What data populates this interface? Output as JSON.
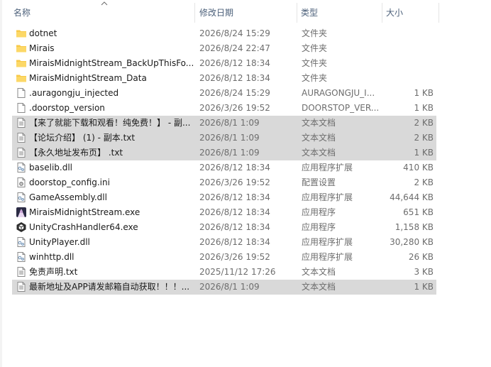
{
  "columns": {
    "name": "名称",
    "date": "修改日期",
    "type": "类型",
    "size": "大小"
  },
  "files": [
    {
      "name": "dotnet",
      "date": "2026/8/24 15:29",
      "type": "文件夹",
      "size": "",
      "icon": "folder-icon",
      "selected": false
    },
    {
      "name": "Mirais",
      "date": "2026/8/24 22:47",
      "type": "文件夹",
      "size": "",
      "icon": "folder-icon",
      "selected": false
    },
    {
      "name": "MiraisMidnightStream_BackUpThisFo...",
      "date": "2026/8/12 18:34",
      "type": "文件夹",
      "size": "",
      "icon": "folder-icon",
      "selected": false
    },
    {
      "name": "MiraisMidnightStream_Data",
      "date": "2026/8/12 18:34",
      "type": "文件夹",
      "size": "",
      "icon": "folder-icon",
      "selected": false
    },
    {
      "name": ".auragongju_injected",
      "date": "2026/8/24 15:29",
      "type": "AURAGONGJU_I...",
      "size": "1 KB",
      "icon": "blank-file-icon",
      "selected": false
    },
    {
      "name": ".doorstop_version",
      "date": "2026/3/26 19:52",
      "type": "DOORSTOP_VER...",
      "size": "1 KB",
      "icon": "blank-file-icon",
      "selected": false
    },
    {
      "name": "【来了就能下载和观看！纯免费！】 - 副...",
      "date": "2026/8/1 1:09",
      "type": "文本文档",
      "size": "2 KB",
      "icon": "text-file-icon",
      "selected": true
    },
    {
      "name": "【论坛介绍】 (1) - 副本.txt",
      "date": "2026/8/1 1:09",
      "type": "文本文档",
      "size": "2 KB",
      "icon": "text-file-icon",
      "selected": true
    },
    {
      "name": "【永久地址发布页】 .txt",
      "date": "2026/8/1 1:09",
      "type": "文本文档",
      "size": "1 KB",
      "icon": "text-file-icon",
      "selected": true
    },
    {
      "name": "baselib.dll",
      "date": "2026/8/12 18:34",
      "type": "应用程序扩展",
      "size": "410 KB",
      "icon": "dll-file-icon",
      "selected": false
    },
    {
      "name": "doorstop_config.ini",
      "date": "2026/3/26 19:52",
      "type": "配置设置",
      "size": "2 KB",
      "icon": "config-file-icon",
      "selected": false
    },
    {
      "name": "GameAssembly.dll",
      "date": "2026/8/12 18:34",
      "type": "应用程序扩展",
      "size": "44,644 KB",
      "icon": "dll-file-icon",
      "selected": false
    },
    {
      "name": "MiraisMidnightStream.exe",
      "date": "2026/8/12 18:34",
      "type": "应用程序",
      "size": "651 KB",
      "icon": "app-exe-icon",
      "selected": false
    },
    {
      "name": "UnityCrashHandler64.exe",
      "date": "2026/8/12 18:34",
      "type": "应用程序",
      "size": "1,158 KB",
      "icon": "unity-exe-icon",
      "selected": false
    },
    {
      "name": "UnityPlayer.dll",
      "date": "2026/8/12 18:34",
      "type": "应用程序扩展",
      "size": "30,280 KB",
      "icon": "dll-file-icon",
      "selected": false
    },
    {
      "name": "winhttp.dll",
      "date": "2026/3/26 19:52",
      "type": "应用程序扩展",
      "size": "26 KB",
      "icon": "dll-file-icon",
      "selected": false
    },
    {
      "name": "免责声明.txt",
      "date": "2025/11/12 17:26",
      "type": "文本文档",
      "size": "3 KB",
      "icon": "text-file-icon",
      "selected": false
    },
    {
      "name": "最新地址及APP请发邮箱自动获取！！！...",
      "date": "2026/8/1 1:09",
      "type": "文本文档",
      "size": "1 KB",
      "icon": "text-file-icon",
      "selected": true
    }
  ]
}
